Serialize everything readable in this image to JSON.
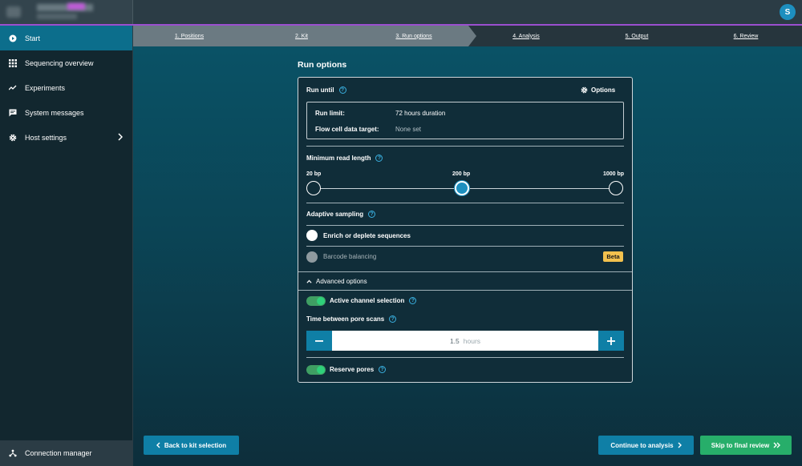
{
  "header": {
    "avatar_initial": "S"
  },
  "sidebar": {
    "items": [
      {
        "label": "Start",
        "icon": "play-circle-icon"
      },
      {
        "label": "Sequencing overview",
        "icon": "grid-icon"
      },
      {
        "label": "Experiments",
        "icon": "activity-icon"
      },
      {
        "label": "System messages",
        "icon": "message-icon"
      },
      {
        "label": "Host settings",
        "icon": "gear-icon"
      }
    ],
    "footer_label": "Connection manager"
  },
  "stepper": {
    "steps": [
      "1. Positions",
      "2. Kit",
      "3. Run options",
      "4. Analysis",
      "5. Output",
      "6. Review"
    ],
    "current": 3
  },
  "page": {
    "title": "Run options"
  },
  "run_until": {
    "label": "Run until",
    "options_label": "Options",
    "run_limit_label": "Run limit:",
    "run_limit_value": "72 hours duration",
    "data_target_label": "Flow cell data target:",
    "data_target_value": "None set"
  },
  "min_read_length": {
    "label": "Minimum read length",
    "ticks": [
      "20 bp",
      "200 bp",
      "1000 bp"
    ],
    "selected": "200 bp"
  },
  "adaptive_sampling": {
    "label": "Adaptive sampling",
    "options": [
      {
        "label": "Enrich or deplete sequences",
        "enabled": true
      },
      {
        "label": "Barcode balancing",
        "enabled": false,
        "badge": "Beta"
      }
    ]
  },
  "advanced": {
    "toggle_label": "Advanced options",
    "active_channel_label": "Active channel selection",
    "active_channel_on": true,
    "pore_scan_label": "Time between pore scans",
    "pore_scan_value": "1.5",
    "pore_scan_unit": "hours",
    "reserve_pores_label": "Reserve pores",
    "reserve_pores_on": true
  },
  "footer": {
    "back_label": "Back to kit selection",
    "continue_label": "Continue to analysis",
    "skip_label": "Skip to final review"
  },
  "colors": {
    "accent_blue": "#0f7fa6",
    "accent_green": "#27ae6a",
    "beta_badge": "#f2c14e",
    "topbar_stripe": "#9b4fd0"
  }
}
